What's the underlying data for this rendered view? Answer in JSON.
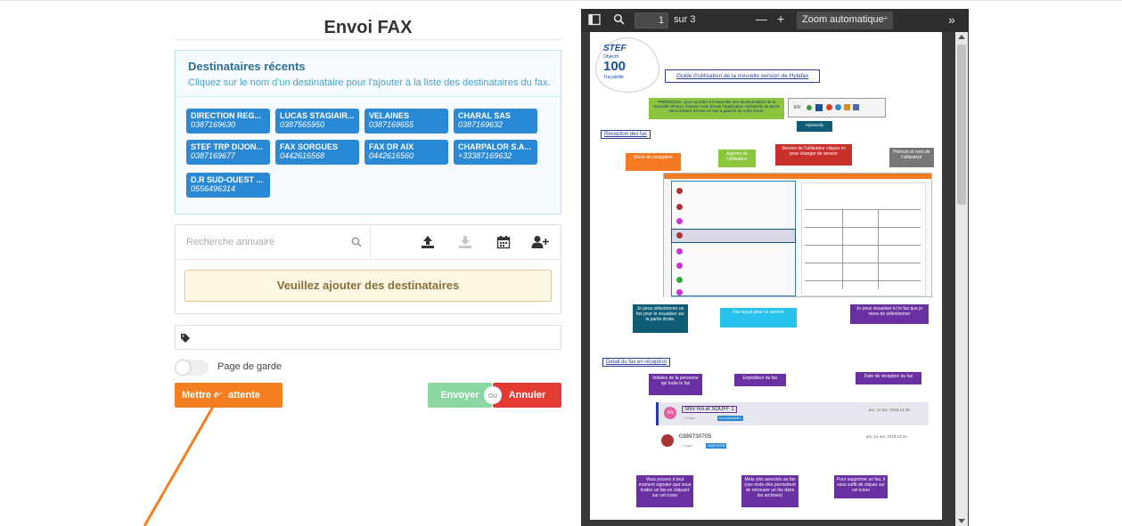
{
  "form": {
    "title": "Envoi FAX",
    "recent": {
      "title": "Destinataires récents",
      "subtitle": "Cliquez sur le nom d'un destinataire pour l'ajouter à la liste des destinataires du fax.",
      "recipients": [
        {
          "name": "DIRECTION REG...",
          "phone": "0387169630"
        },
        {
          "name": "LUCAS STAGIAIR...",
          "phone": "0387565950"
        },
        {
          "name": "VELAINES",
          "phone": "0387169655"
        },
        {
          "name": "CHARAL SAS",
          "phone": "0387169632"
        },
        {
          "name": "STEF TRP DIJON...",
          "phone": "0387169677"
        },
        {
          "name": "FAX SORGUES",
          "phone": "0442616568"
        },
        {
          "name": "FAX DR AIX",
          "phone": "0442616560"
        },
        {
          "name": "CHARPALOR S.A...",
          "phone": "+33387169632"
        },
        {
          "name": "D.R SUD-OUEST ...",
          "phone": "0556496314"
        }
      ]
    },
    "search_placeholder": "Recherche annuaire",
    "empty_recipients": "Veuillez ajouter des destinataires",
    "cover_page_label": "Page de garde",
    "hold_button": "Mettre en attente",
    "send_button": "Envoyer",
    "or_label": "ou",
    "cancel_button": "Annuler"
  },
  "viewer": {
    "page_current": "1",
    "page_total": "sur 3",
    "zoom": "Zoom automatique",
    "zoom_out": "—",
    "zoom_in": "+",
    "more": "»"
  },
  "pdf": {
    "logo_brand": "STEF",
    "logo_sub": "Objectif",
    "logo_num": "100",
    "logo_trace": "Traçabilité",
    "guide_title": "Guide d'utilisation de la nouvelle version de Hylafax",
    "prereq": "PRÉREQUIS : pour accéder à l'ensemble des fonctionnalités de la nouvelle version, Assurez vous d'avoir l'application HylaNotify de lancé dans la barre d'icone en bas à gauche de votre écran.",
    "hylanotify": "HylaNotify",
    "section_reception": "Réception des fax",
    "section_detail": "Detail du fax en réception",
    "callouts": {
      "agence": "Agence de l'utilisateur",
      "service": "Service de l'utilisateur cliquez ici pour changer de service",
      "prenom": "Prénom et nom de l'utilisateur",
      "menu": "Menu de navigation",
      "select_fax": "Je peux sélectionner un fax pour le visualiser sur la partie droite.",
      "fax_recus": "Fax reçus pour ce service",
      "visualiser": "Je peux visualiser ici le fax que je viens de sélectionner",
      "initiales": "Initiales de la personne qui traite le fax",
      "expediteur": "Expéditeur du fax",
      "date_reception": "Date de réception du fax",
      "signaler": "Vous pouvez à tout moment signaler que vous traitez un fax en cliquant sur cet icone",
      "mots_cles": "Mots clés associés au fax (ces mots-clés permettent de retrouver un fax dans les archives)",
      "supprimer": "Pour supprimer un fax, il vous suffit de cliquer sur cet icone"
    },
    "detail": {
      "initials": "AS",
      "sender1": "SNV RA et SOUFF 1",
      "date1": "jeu. 12 avr. 2018 15:48",
      "pages1": "1 Pages",
      "tag1": "snv ra et souff 1",
      "sender2": "0389730705",
      "date2": "jeu. 12 avr. 2018 15:42",
      "pages2": "1 Pages",
      "tag2": "0389730705"
    }
  },
  "colors": {
    "chip": "#2a89d4",
    "hold": "#f47f20",
    "send": "#8ad7a2",
    "cancel": "#e53b35",
    "annotation_arrow": "#f47f20"
  }
}
